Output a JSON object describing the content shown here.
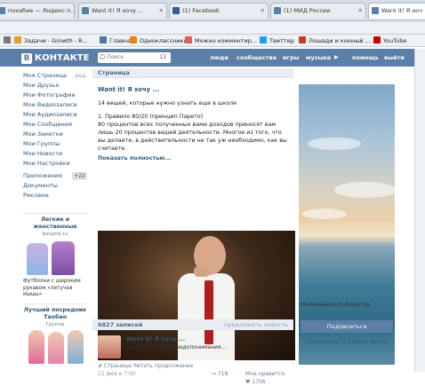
{
  "tabs": [
    {
      "label": "похабие — Яндекс: ..."
    },
    {
      "label": "Want it! Я хочу ..."
    },
    {
      "label": "(1) Facebook"
    },
    {
      "label": "(1) МИД России"
    },
    {
      "label": "Want it! Я хоч"
    }
  ],
  "bookmarks": [
    {
      "label": "Задачи - Growth - R...",
      "color": "#e0a020"
    },
    {
      "label": "Главная",
      "color": "#4a76a8"
    },
    {
      "label": "Одноклассники",
      "color": "#ee8208"
    },
    {
      "label": "Можно комментир...",
      "color": "#e06060"
    },
    {
      "label": "Твиттер",
      "color": "#1da1f2"
    },
    {
      "label": "Лошади и конный ...",
      "color": "#c04020"
    },
    {
      "label": "YouTube",
      "color": "#cc0000"
    }
  ],
  "header": {
    "logo_b": "В",
    "logo_text": "КОНТАКТЕ",
    "search_placeholder": "Поиск",
    "search_count": "13",
    "nav": [
      "люди",
      "сообщества",
      "игры",
      "музыка",
      "помощь",
      "выйти"
    ]
  },
  "leftnav": {
    "items": [
      "Моя Страница",
      "Мои Друзья",
      "Мои Фотографии",
      "Мои Видеозаписи",
      "Мои Аудиозаписи",
      "Мои Сообщения",
      "Мои Заметки",
      "Мои Группы",
      "Мои Новости",
      "Мои Настройки"
    ],
    "edit_label": "ред.",
    "apps_label": "Приложения",
    "apps_badge": "+22",
    "extra": [
      "Документы",
      "Реклама"
    ]
  },
  "ads": {
    "ad1_title": "Легкие и женственные",
    "ad1_domain": "bonprix.ru",
    "ad1_text": "Футболки с широким рукавом «летучая мышь»",
    "ad2_title": "Лучший посредник Таобао",
    "ad2_sub": "Группа"
  },
  "main": {
    "head": "Страница",
    "post_title": "Want it! Я хочу ...",
    "post_intro": "14 вещей, которые нужно узнать еще в школе",
    "post_p1": "1. Правило 80/20 (принцип Парето)",
    "post_p2": "80 процентов всех полученных вами доходов приносят вам лишь 20 процентов вашей деятельности. Многое из того, что вы делаете, в действительности не так уж необходимо, как вы считаете.",
    "show_more": "Показать полностью...",
    "foot_link": "Страница Читать продолжение",
    "foot_date": "11 фев в 7:00",
    "foot_shares": "718",
    "foot_likes_label": "Мне нравится",
    "foot_likes": "1706",
    "records_label": "6827 записей",
    "records_right": "предложить новость",
    "post2_title": "Want it! Я хочу ...",
    "post2_text": "... чтобы не было недопонимания..."
  },
  "right": {
    "caption": "Упоминания сообщества",
    "subscribe": "Подписаться",
    "friends": "Подписаны 2 Ваших друга"
  }
}
